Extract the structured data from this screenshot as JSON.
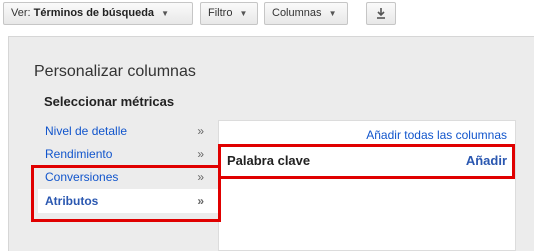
{
  "toolbar": {
    "view_prefix": "Ver:",
    "view_value": "Términos de búsqueda",
    "filter_label": "Filtro",
    "columns_label": "Columnas",
    "download_icon": "download-icon"
  },
  "dialog": {
    "title": "Personalizar columnas",
    "metrics_heading": "Seleccionar métricas",
    "categories": [
      {
        "label": "Nivel de detalle",
        "selected": false
      },
      {
        "label": "Rendimiento",
        "selected": false
      },
      {
        "label": "Conversiones",
        "selected": false
      },
      {
        "label": "Atributos",
        "selected": true
      }
    ],
    "chevron": "»",
    "add_all_label": "Añadir todas las columnas",
    "metric_row": {
      "name": "Palabra clave",
      "add_label": "Añadir"
    }
  },
  "colors": {
    "link": "#1155cc",
    "highlight": "#e00000",
    "panel_bg": "#ececec"
  }
}
